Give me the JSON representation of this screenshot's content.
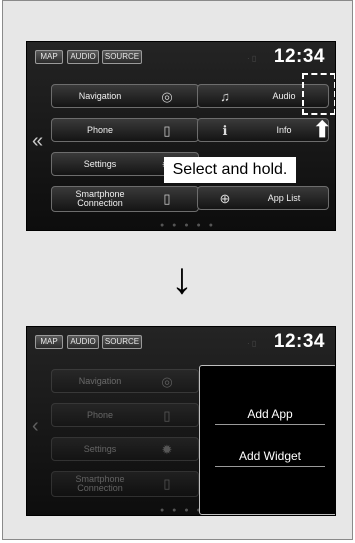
{
  "top_bar": {
    "map_label": "MAP",
    "audio_label": "AUDIO",
    "source_label": "SOURCE",
    "clock": "12:34"
  },
  "home_tiles": {
    "navigation": "Navigation",
    "phone": "Phone",
    "settings": "Settings",
    "smartphone_connection": "Smartphone Connection",
    "audio": "Audio",
    "info": "Info",
    "app_list": "App List"
  },
  "callout": {
    "text": "Select and hold."
  },
  "popup": {
    "add_app": "Add App",
    "add_widget": "Add Widget"
  },
  "icons": {
    "back_arrow": "chevron-left-icon",
    "down_arrow": "arrow-down-icon",
    "up_arrow": "arrow-up-icon"
  }
}
